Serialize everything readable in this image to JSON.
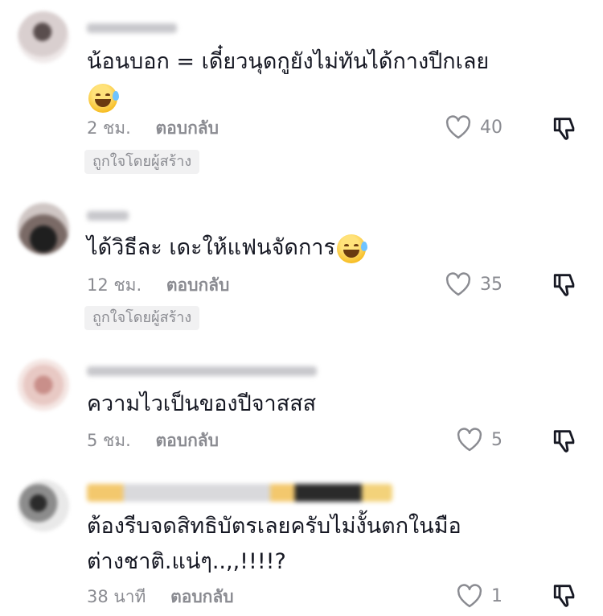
{
  "comments": [
    {
      "text": "น้อนบอก = เดี๋ยวนุดกูยังไม่ทันได้กางปีกเลย",
      "emoji": "sweat-smile-emoji",
      "time": "2 ชม.",
      "reply": "ตอบกลับ",
      "likes": "40",
      "badge": "ถูกใจโดยผู้สร้าง"
    },
    {
      "text": "ได้วิธีละ เดะให้แฟนจัดการ",
      "emoji": "tears-of-joy-emoji",
      "time": "12 ชม.",
      "reply": "ตอบกลับ",
      "likes": "35",
      "badge": "ถูกใจโดยผู้สร้าง"
    },
    {
      "text": "ความไวเป็นของปีจาสสส",
      "time": "5 ชม.",
      "reply": "ตอบกลับ",
      "likes": "5"
    },
    {
      "text": "ต้องรีบจดสิทธิบัตรเลยครับไม่งั้นตกในมือ\nต่างชาติ.แน่ๆ..,,!!!!?",
      "time": "38 นาที",
      "reply": "ตอบกลับ",
      "likes": "1"
    }
  ],
  "colors": {
    "text": "#161823",
    "muted": "#8a8b91",
    "badge_bg": "#f1f1f2"
  },
  "icons": {
    "like": "heart-outline-icon",
    "dislike": "thumbs-down-icon"
  }
}
